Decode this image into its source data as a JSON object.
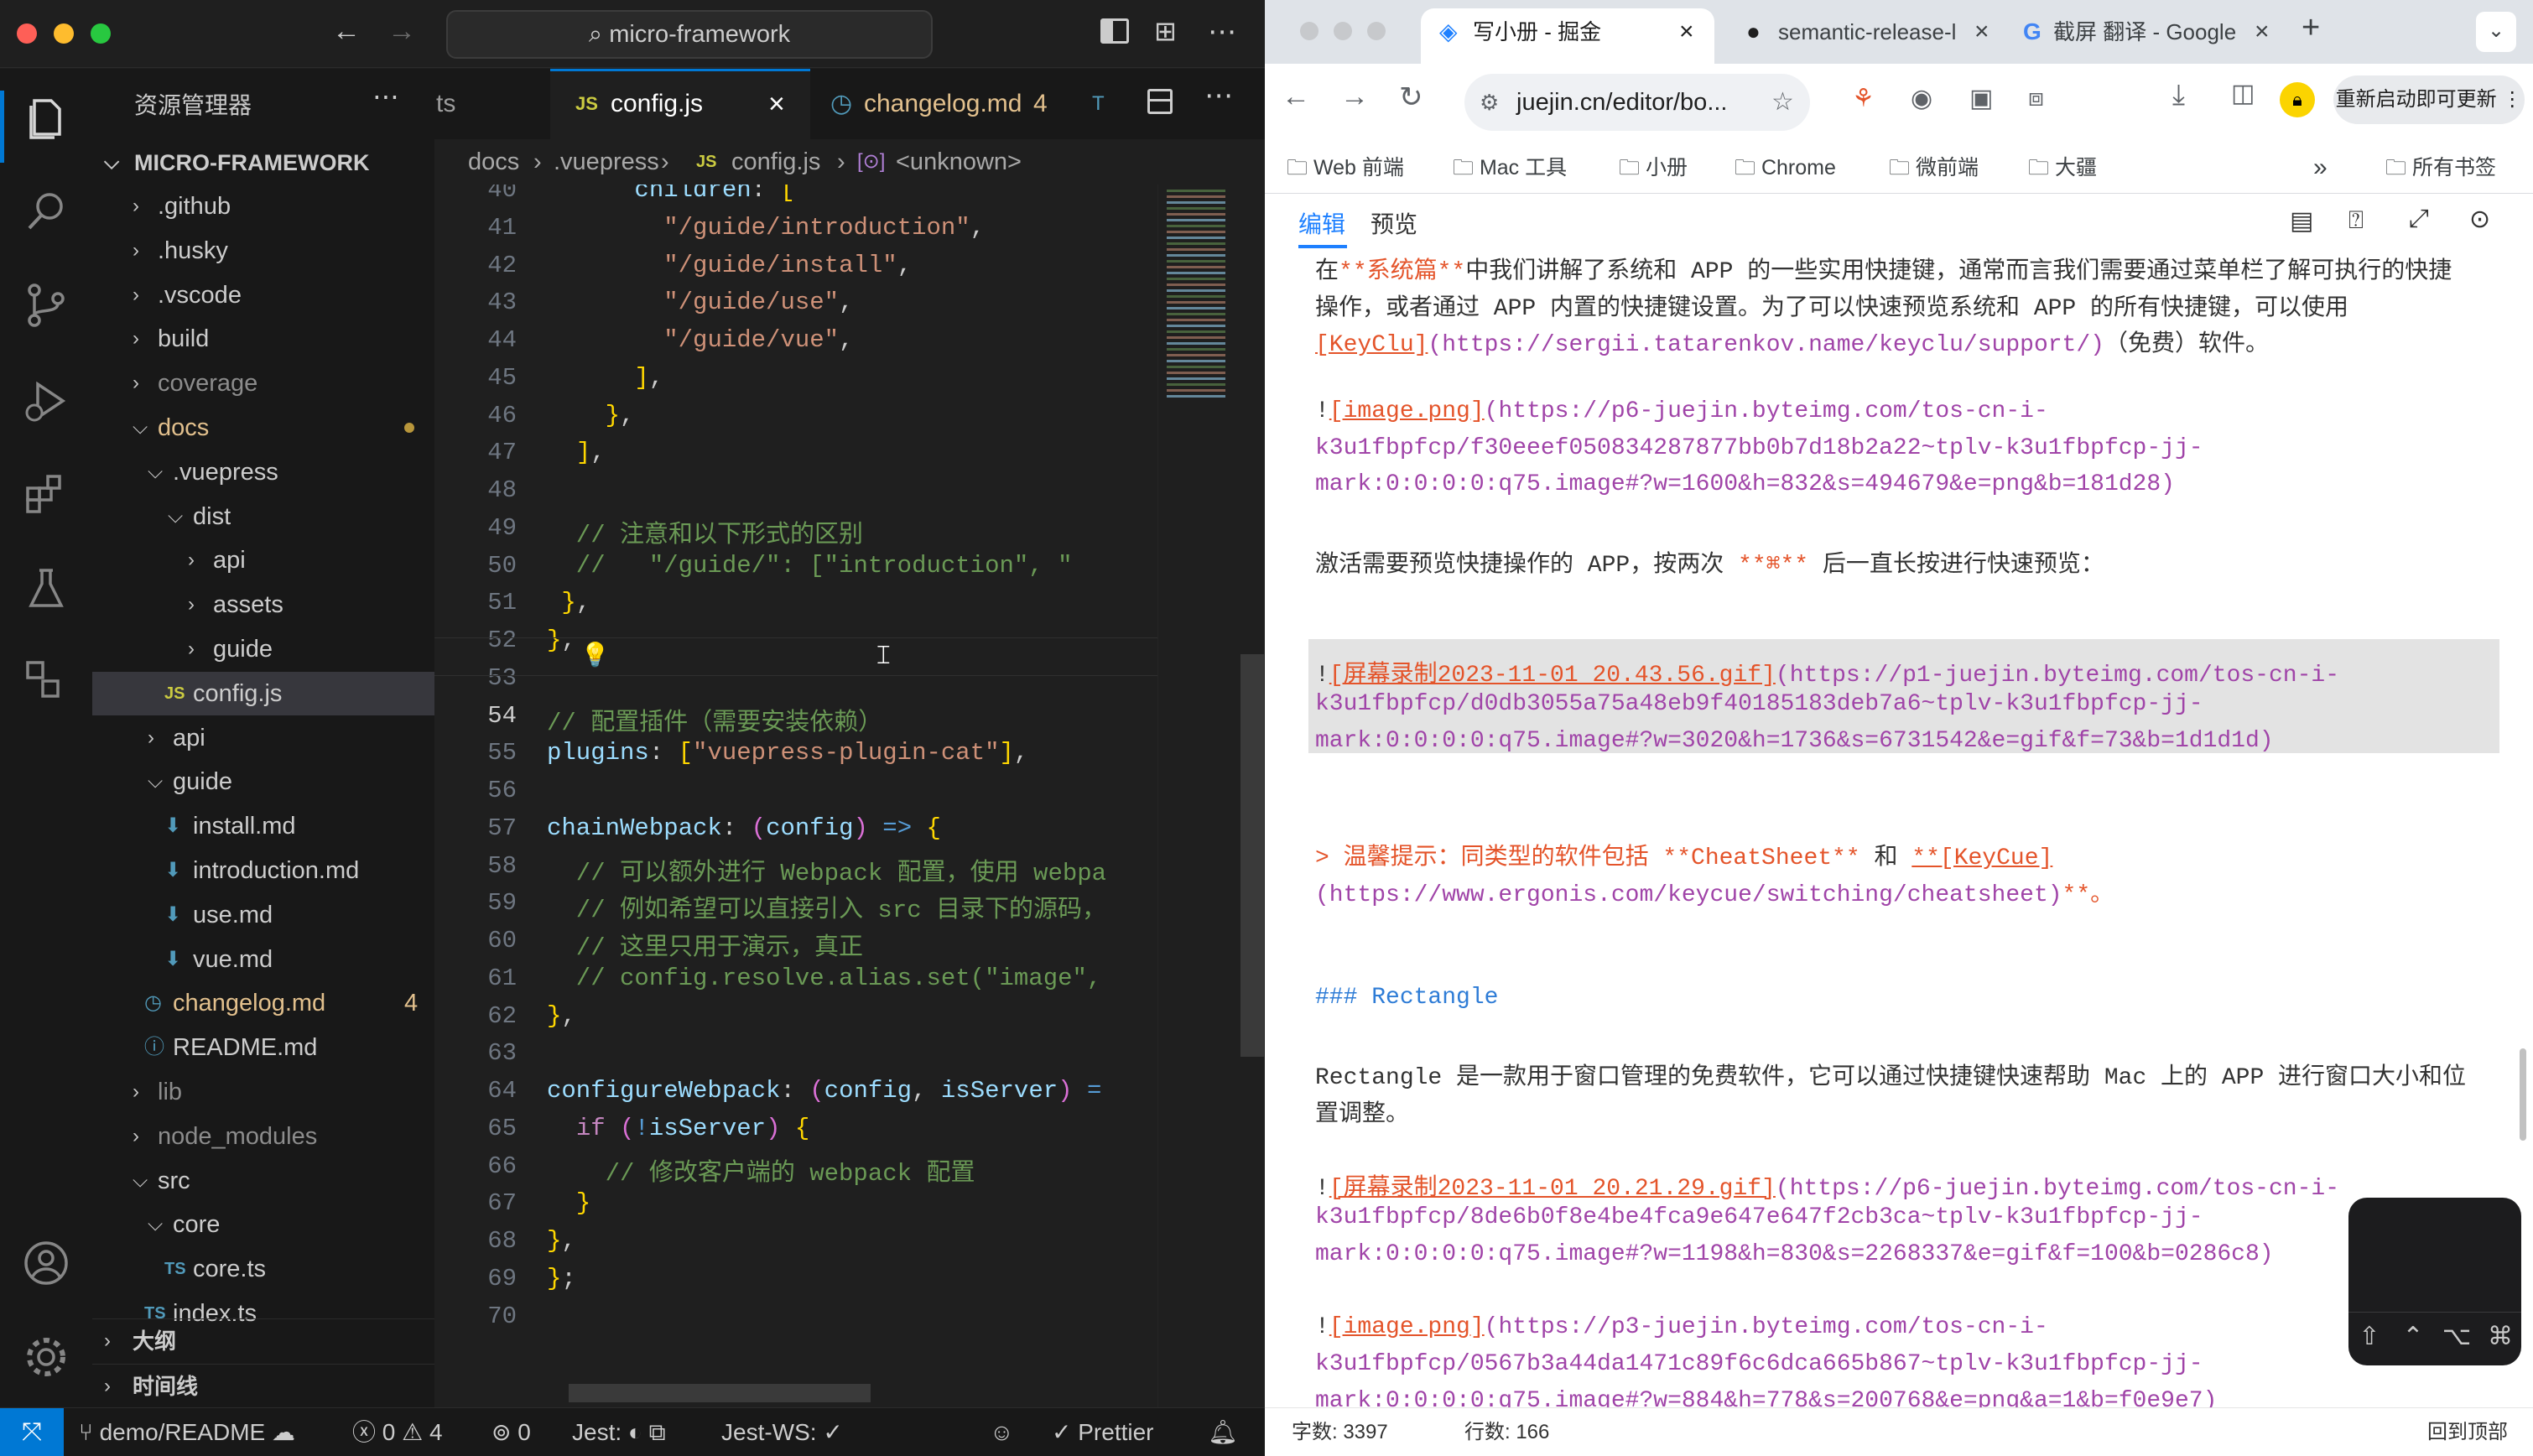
{
  "vscode": {
    "search_text": "micro-framework",
    "sidebar_title": "资源管理器",
    "root_folder": "MICRO-FRAMEWORK",
    "tree": [
      {
        "label": ".github",
        "kind": "folder",
        "depth": 1,
        "expanded": false
      },
      {
        "label": ".husky",
        "kind": "folder",
        "depth": 1,
        "expanded": false
      },
      {
        "label": ".vscode",
        "kind": "folder",
        "depth": 1,
        "expanded": false
      },
      {
        "label": "build",
        "kind": "folder",
        "depth": 1,
        "expanded": false
      },
      {
        "label": "coverage",
        "kind": "folder",
        "depth": 1,
        "expanded": false
      },
      {
        "label": "docs",
        "kind": "folder",
        "depth": 1,
        "expanded": true
      },
      {
        "label": ".vuepress",
        "kind": "folder",
        "depth": 2,
        "expanded": true
      },
      {
        "label": "dist",
        "kind": "folder",
        "depth": 3,
        "expanded": true
      },
      {
        "label": "api",
        "kind": "folder",
        "depth": 4,
        "expanded": false
      },
      {
        "label": "assets",
        "kind": "folder",
        "depth": 4,
        "expanded": false
      },
      {
        "label": "guide",
        "kind": "folder",
        "depth": 4,
        "expanded": false
      },
      {
        "label": "config.js",
        "kind": "js",
        "depth": 3,
        "selected": true
      },
      {
        "label": "api",
        "kind": "folder",
        "depth": 2,
        "expanded": false
      },
      {
        "label": "guide",
        "kind": "folder",
        "depth": 2,
        "expanded": true
      },
      {
        "label": "install.md",
        "kind": "md",
        "depth": 3
      },
      {
        "label": "introduction.md",
        "kind": "md",
        "depth": 3
      },
      {
        "label": "use.md",
        "kind": "md",
        "depth": 3
      },
      {
        "label": "vue.md",
        "kind": "md",
        "depth": 3
      },
      {
        "label": "changelog.md",
        "kind": "changelog",
        "depth": 2,
        "badge": "4"
      },
      {
        "label": "README.md",
        "kind": "info",
        "depth": 2
      },
      {
        "label": "lib",
        "kind": "folder",
        "depth": 1,
        "expanded": false
      },
      {
        "label": "node_modules",
        "kind": "folder",
        "depth": 1,
        "expanded": false
      },
      {
        "label": "src",
        "kind": "folder",
        "depth": 1,
        "expanded": true
      },
      {
        "label": "core",
        "kind": "folder",
        "depth": 2,
        "expanded": true
      },
      {
        "label": "core.ts",
        "kind": "ts",
        "depth": 3
      },
      {
        "label": "index.ts",
        "kind": "ts",
        "depth": 2
      }
    ],
    "outline_label": "大纲",
    "timeline_label": "时间线",
    "tabs": [
      {
        "label": "ts"
      },
      {
        "label": "config.js",
        "active": true
      },
      {
        "label": "changelog.md",
        "badge": "4"
      },
      {
        "label": "T"
      }
    ],
    "breadcrumb": [
      "docs",
      ".vuepress",
      "config.js",
      "<unknown>"
    ],
    "code_lines": [
      {
        "n": "40",
        "text": "      children: ["
      },
      {
        "n": "41",
        "text": "        \"/guide/introduction\","
      },
      {
        "n": "42",
        "text": "        \"/guide/install\","
      },
      {
        "n": "43",
        "text": "        \"/guide/use\","
      },
      {
        "n": "44",
        "text": "        \"/guide/vue\","
      },
      {
        "n": "45",
        "text": "      ],"
      },
      {
        "n": "46",
        "text": "    },"
      },
      {
        "n": "47",
        "text": "  ],"
      },
      {
        "n": "48",
        "text": ""
      },
      {
        "n": "49",
        "text": "  // 注意和以下形式的区别"
      },
      {
        "n": "50",
        "text": "  //   \"/guide/\": [\"introduction\", \""
      },
      {
        "n": "51",
        "text": " },"
      },
      {
        "n": "52",
        "text": "},"
      },
      {
        "n": "53",
        "text": ""
      },
      {
        "n": "54",
        "text": "// 配置插件（需要安装依赖）"
      },
      {
        "n": "55",
        "text": "plugins: [\"vuepress-plugin-cat\"],"
      },
      {
        "n": "56",
        "text": ""
      },
      {
        "n": "57",
        "text": "chainWebpack: (config) => {"
      },
      {
        "n": "58",
        "text": "  // 可以额外进行 Webpack 配置，使用 webpa"
      },
      {
        "n": "59",
        "text": "  // 例如希望可以直接引入 src 目录下的源码，"
      },
      {
        "n": "60",
        "text": "  // 这里只用于演示，真正"
      },
      {
        "n": "61",
        "text": "  // config.resolve.alias.set(\"image\","
      },
      {
        "n": "62",
        "text": "},"
      },
      {
        "n": "63",
        "text": ""
      },
      {
        "n": "64",
        "text": "configureWebpack: (config, isServer) ="
      },
      {
        "n": "65",
        "text": "  if (!isServer) {"
      },
      {
        "n": "66",
        "text": "    // 修改客户端的 webpack 配置"
      },
      {
        "n": "67",
        "text": "  }"
      },
      {
        "n": "68",
        "text": "},"
      },
      {
        "n": "69",
        "text": "};"
      },
      {
        "n": "70",
        "text": ""
      }
    ],
    "status": {
      "branch": "demo/README",
      "errors": "0",
      "warnings": "4",
      "ports": "0",
      "jest": "Jest:",
      "jest_ws": "Jest-WS: ✓",
      "prettier": "Prettier"
    }
  },
  "chrome": {
    "tabs": [
      {
        "label": "写小册 - 掘金",
        "active": true
      },
      {
        "label": "semantic-release-l"
      },
      {
        "label": "截屏 翻译 - Google"
      }
    ],
    "url": "juejin.cn/editor/bo...",
    "update_button": "重新启动即可更新",
    "bookmarks": [
      "Web 前端",
      "Mac 工具",
      "小册",
      "Chrome",
      "微前端",
      "大疆"
    ],
    "all_bookmarks": "所有书签",
    "editor_tabs": {
      "edit": "编辑",
      "preview": "预览"
    },
    "md_lines": [
      [
        {
          "t": "在"
        },
        {
          "t": "**系统篇**",
          "c": "red"
        },
        {
          "t": "中我们讲解了系统和 APP 的一些实用快捷键，通常而言我们需要通过菜单栏了解可执行的快捷"
        }
      ],
      [
        {
          "t": "操作，或者通过 APP 内置的快捷键设置。为了可以快速预览系统和 APP 的所有快捷键，可以使用"
        }
      ],
      [
        {
          "t": "[KeyClu]",
          "c": "red",
          "u": true
        },
        {
          "t": "(https://sergii.tatarenkov.name/keyclu/support/)",
          "c": "purple"
        },
        {
          "t": "（免费）软件。"
        }
      ],
      [],
      [
        {
          "t": "!"
        },
        {
          "t": "[image.png]",
          "c": "red",
          "u": true
        },
        {
          "t": "(https://p6-juejin.byteimg.com/tos-cn-i-",
          "c": "purple"
        }
      ],
      [
        {
          "t": "k3u1fbpfcp/f30eeef050834287877bb0b7d18b2a22~tplv-k3u1fbpfcp-jj-",
          "c": "purple"
        }
      ],
      [
        {
          "t": "mark:0:0:0:0:q75.image#?w=1600&h=832&s=494679&e=png&b=181d28)",
          "c": "purple"
        }
      ],
      [],
      [
        {
          "t": "激活需要预览快捷操作的 APP，按两次 "
        },
        {
          "t": "**⌘**",
          "c": "red"
        },
        {
          "t": " 后一直长按进行快速预览："
        }
      ],
      [],
      [],
      [
        {
          "t": "!"
        },
        {
          "t": "[屏幕录制2023-11-01 20.43.56.gif]",
          "c": "red",
          "u": true
        },
        {
          "t": "(https://p1-juejin.byteimg.com/tos-cn-i-",
          "c": "purple"
        }
      ],
      [
        {
          "t": "k3u1fbpfcp/d0db3055a75a48eb9f40185183deb7a6~tplv-k3u1fbpfcp-jj-",
          "c": "purple"
        }
      ],
      [
        {
          "t": "mark:0:0:0:0:q75.image#?w=3020&h=1736&s=6731542&e=gif&f=73&b=1d1d1d)",
          "c": "purple"
        }
      ],
      [],
      [],
      [
        {
          "t": "> 温馨提示：同类型的软件包括 ",
          "c": "red"
        },
        {
          "t": "**CheatSheet**",
          "c": "red"
        },
        {
          "t": " 和 "
        },
        {
          "t": "**[KeyCue]",
          "c": "red",
          "u": true
        }
      ],
      [
        {
          "t": "(https://www.ergonis.com/keycue/switching/cheatsheet)",
          "c": "purple"
        },
        {
          "t": "**。",
          "c": "red"
        }
      ],
      [],
      [],
      [
        {
          "t": "### Rectangle",
          "c": "blue"
        }
      ],
      [],
      [
        {
          "t": "Rectangle 是一款用于窗口管理的免费软件，它可以通过快捷键快速帮助 Mac 上的 APP 进行窗口大小和位"
        }
      ],
      [
        {
          "t": "置调整。"
        }
      ],
      [],
      [
        {
          "t": "!"
        },
        {
          "t": "[屏幕录制2023-11-01 20.21.29.gif]",
          "c": "red",
          "u": true
        },
        {
          "t": "(https://p6-juejin.byteimg.com/tos-cn-i-",
          "c": "purple"
        }
      ],
      [
        {
          "t": "k3u1fbpfcp/8de6b0f8e4be4fca9e647e647f2cb3ca~tplv-k3u1fbpfcp-jj-",
          "c": "purple"
        }
      ],
      [
        {
          "t": "mark:0:0:0:0:q75.image#?w=1198&h=830&s=2268337&e=gif&f=100&b=0286c8)",
          "c": "purple"
        }
      ],
      [],
      [
        {
          "t": "!"
        },
        {
          "t": "[image.png]",
          "c": "red",
          "u": true
        },
        {
          "t": "(https://p3-juejin.byteimg.com/tos-cn-i-",
          "c": "purple"
        }
      ],
      [
        {
          "t": "k3u1fbpfcp/0567b3a44da1471c89f6c6dca665b867~tplv-k3u1fbpfcp-jj-",
          "c": "purple"
        }
      ],
      [
        {
          "t": "mark:0:0:0:0:q75.image#?w=884&h=778&s=200768&e=png&a=1&b=f0e9e7)",
          "c": "purple"
        }
      ]
    ],
    "word_count": "字数: 3397",
    "line_count": "行数: 166",
    "back_to_top": "回到顶部",
    "keys": [
      "⇧",
      "⌃",
      "⌥",
      "⌘"
    ]
  }
}
